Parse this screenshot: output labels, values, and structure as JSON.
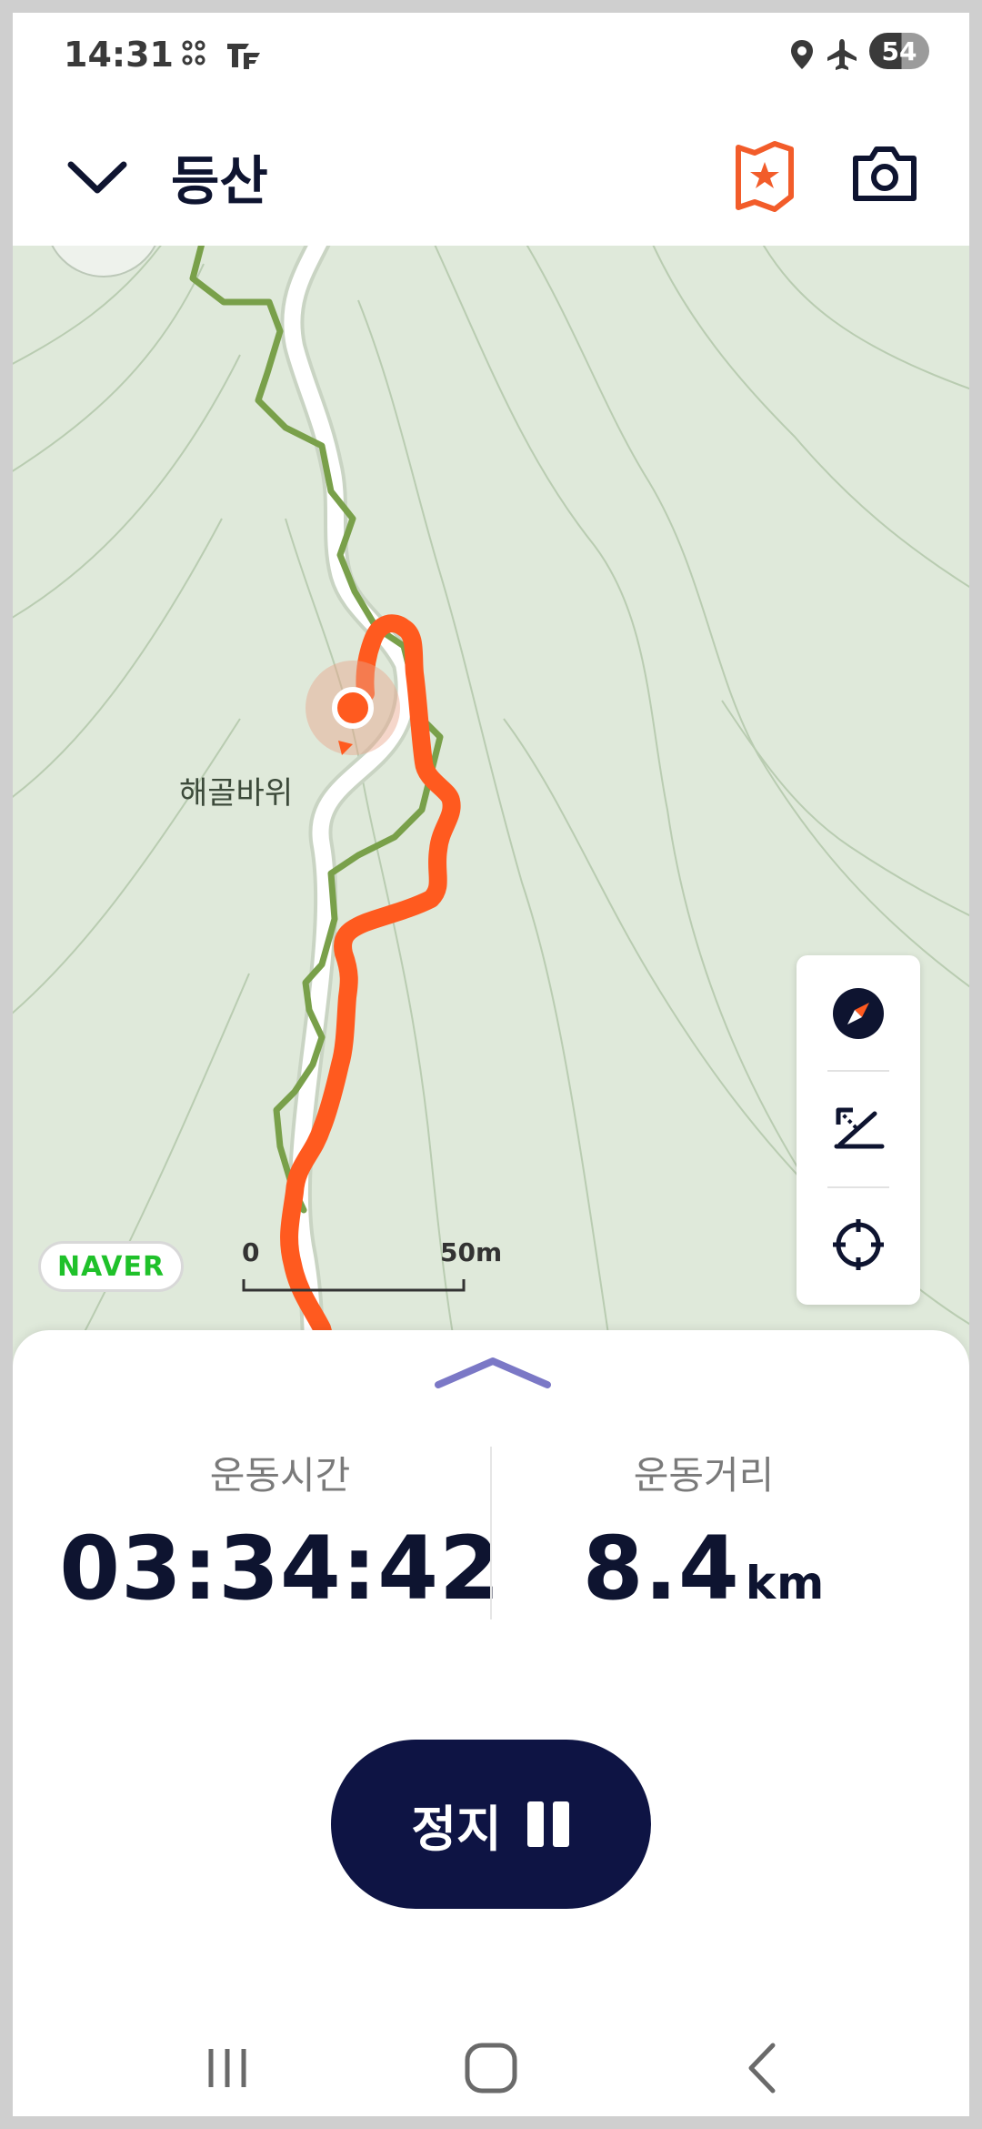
{
  "status_bar": {
    "time": "14:31",
    "battery": "54",
    "icons": [
      "grid-dots-icon",
      "tf-app-icon",
      "location-icon",
      "airplane-icon"
    ]
  },
  "header": {
    "title": "등산",
    "back_icon": "chevron-down-icon",
    "badge_icon": "star-flag-icon",
    "camera_icon": "camera-icon",
    "accent": "#f25c2a"
  },
  "map": {
    "place_label": "해골바위",
    "provider_logo": "NAVER",
    "scale_start": "0",
    "scale_end": "50m",
    "controls": [
      "compass-icon",
      "slope-icon",
      "locate-icon"
    ],
    "route_color": "#ff5a1f",
    "trail_color": "#79a04a",
    "road_color": "#ffffff"
  },
  "stats": {
    "time_label": "운동시간",
    "time_value": "03:34:42",
    "distance_label": "운동거리",
    "distance_value": "8.4",
    "distance_unit": "km"
  },
  "stop_button": {
    "label": "정지",
    "icon": "pause-icon",
    "color": "#0e1444"
  },
  "nav_bar": [
    "recent-apps-icon",
    "home-icon",
    "back-icon"
  ]
}
